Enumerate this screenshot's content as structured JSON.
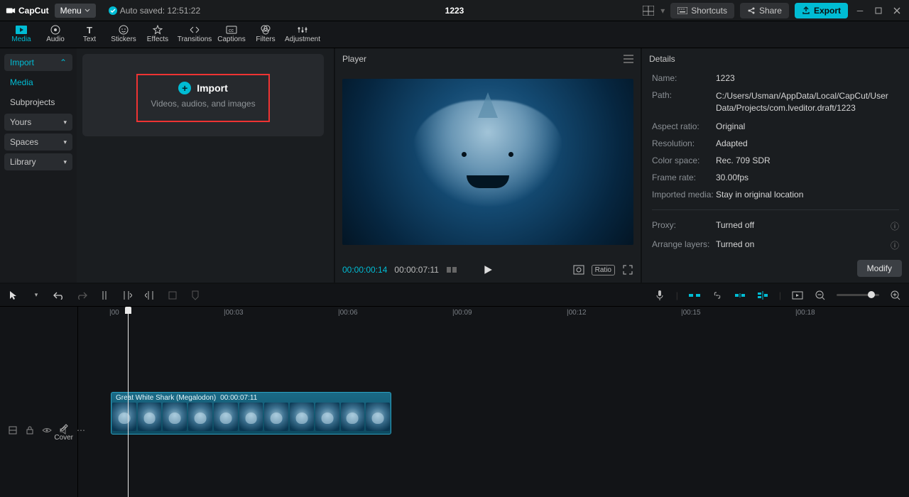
{
  "app": {
    "name": "CapCut",
    "menu": "Menu",
    "autosave": "Auto saved: 12:51:22",
    "project": "1223"
  },
  "title_btns": {
    "shortcuts": "Shortcuts",
    "share": "Share",
    "export": "Export"
  },
  "tabs": [
    "Media",
    "Audio",
    "Text",
    "Stickers",
    "Effects",
    "Transitions",
    "Captions",
    "Filters",
    "Adjustment"
  ],
  "media_side": {
    "import": "Import",
    "media": "Media",
    "subprojects": "Subprojects",
    "yours": "Yours",
    "spaces": "Spaces",
    "library": "Library"
  },
  "import_card": {
    "title": "Import",
    "subtitle": "Videos, audios, and images"
  },
  "player": {
    "title": "Player",
    "current": "00:00:00:14",
    "duration": "00:00:07:11",
    "ratio_label": "Ratio"
  },
  "details": {
    "title": "Details",
    "rows": {
      "name": {
        "k": "Name:",
        "v": "1223"
      },
      "path": {
        "k": "Path:",
        "v": "C:/Users/Usman/AppData/Local/CapCut/User Data/Projects/com.lveditor.draft/1223"
      },
      "aspect": {
        "k": "Aspect ratio:",
        "v": "Original"
      },
      "res": {
        "k": "Resolution:",
        "v": "Adapted"
      },
      "cs": {
        "k": "Color space:",
        "v": "Rec. 709 SDR"
      },
      "fr": {
        "k": "Frame rate:",
        "v": "30.00fps"
      },
      "im": {
        "k": "Imported media:",
        "v": "Stay in original location"
      },
      "proxy": {
        "k": "Proxy:",
        "v": "Turned off"
      },
      "layers": {
        "k": "Arrange layers:",
        "v": "Turned on"
      }
    },
    "modify": "Modify"
  },
  "ruler": [
    "|00",
    "|00:03",
    "|00:06",
    "|00:09",
    "|00:12",
    "|00:15",
    "|00:18"
  ],
  "clip": {
    "name": "Great White Shark (Megalodon)",
    "dur": "00:00:07:11"
  },
  "cover": "Cover"
}
